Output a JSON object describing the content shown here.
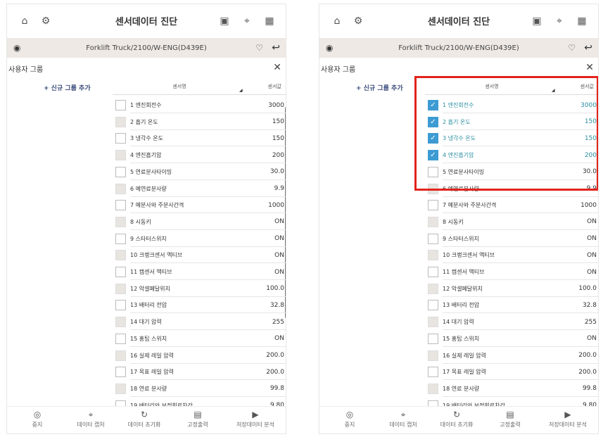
{
  "title": "센서데이터 진단",
  "vehicle": "Forklift Truck/2100/W-ENG(D439E)",
  "group_label": "사용자 그룹",
  "add_group": "+ 신규 그룹 추가",
  "columns": {
    "name": "센서명",
    "value": "센서값"
  },
  "close_glyph": "✕",
  "bottom": {
    "stop": "중지",
    "capture": "데이터 캡처",
    "reset": "데이터 초기화",
    "fixed_output": "고정출력",
    "saved_analysis": "저장데이터 분석"
  },
  "left_rows": [
    {
      "name": "1 엔진회전수",
      "value": "3000"
    },
    {
      "name": "2 흡기 온도",
      "value": "150"
    },
    {
      "name": "3 냉각수 온도",
      "value": "150"
    },
    {
      "name": "4 엔진흡기압",
      "value": "200"
    },
    {
      "name": "5 연료분사타이밍",
      "value": "30.0"
    },
    {
      "name": "6 예연료분사량",
      "value": "9.9"
    },
    {
      "name": "7 예분사와 주분사간격",
      "value": "1000"
    },
    {
      "name": "8 시동키",
      "value": "ON"
    },
    {
      "name": "9 스타터스위치",
      "value": "ON"
    },
    {
      "name": "10 크랭크센서 액티브",
      "value": "ON"
    },
    {
      "name": "11 캠센서 액티브",
      "value": "ON"
    },
    {
      "name": "12 악셀페달위치",
      "value": "100.0"
    },
    {
      "name": "13 배터리 전압",
      "value": "32.8"
    },
    {
      "name": "14 대기 압력",
      "value": "255"
    },
    {
      "name": "15 홍팁 스위치",
      "value": "ON"
    },
    {
      "name": "16 실제 레일 압력",
      "value": "200.0"
    },
    {
      "name": "17 목표 레일 압력",
      "value": "200.0"
    },
    {
      "name": "18 연료 분사량",
      "value": "99.8"
    },
    {
      "name": "19 배터리와 보정회로차간",
      "value": "9.80"
    }
  ],
  "right_rows": [
    {
      "name": "1 엔진회전수",
      "value": "3000",
      "checked": true
    },
    {
      "name": "2 흡기 온도",
      "value": "150",
      "checked": true
    },
    {
      "name": "3 냉각수 온도",
      "value": "150",
      "checked": true
    },
    {
      "name": "4 엔진흡기압",
      "value": "200",
      "checked": true
    },
    {
      "name": "5 연료분사타이밍",
      "value": "30.0",
      "checked": false
    },
    {
      "name": "6 예연료분사량",
      "value": "9.9",
      "checked": false
    },
    {
      "name": "7 예분사와 주분사간격",
      "value": "1000",
      "checked": false
    },
    {
      "name": "8 시동키",
      "value": "ON",
      "checked": false
    },
    {
      "name": "9 스타터스위치",
      "value": "ON",
      "checked": false
    },
    {
      "name": "10 크랭크센서 액티브",
      "value": "ON",
      "checked": false
    },
    {
      "name": "11 캠센서 액티브",
      "value": "ON",
      "checked": false
    },
    {
      "name": "12 악셀페달위치",
      "value": "100.0",
      "checked": false
    },
    {
      "name": "13 배터리 전압",
      "value": "32.8",
      "checked": false
    },
    {
      "name": "14 대기 압력",
      "value": "255",
      "checked": false
    },
    {
      "name": "15 홍팁 스위치",
      "value": "ON",
      "checked": false
    },
    {
      "name": "16 실제 레일 압력",
      "value": "200.0",
      "checked": false
    },
    {
      "name": "17 목표 레일 압력",
      "value": "200.0",
      "checked": false
    },
    {
      "name": "18 연료 분사량",
      "value": "99.8",
      "checked": false
    },
    {
      "name": "19 배터리와 보정회로차간",
      "value": "9.80",
      "checked": false
    }
  ]
}
